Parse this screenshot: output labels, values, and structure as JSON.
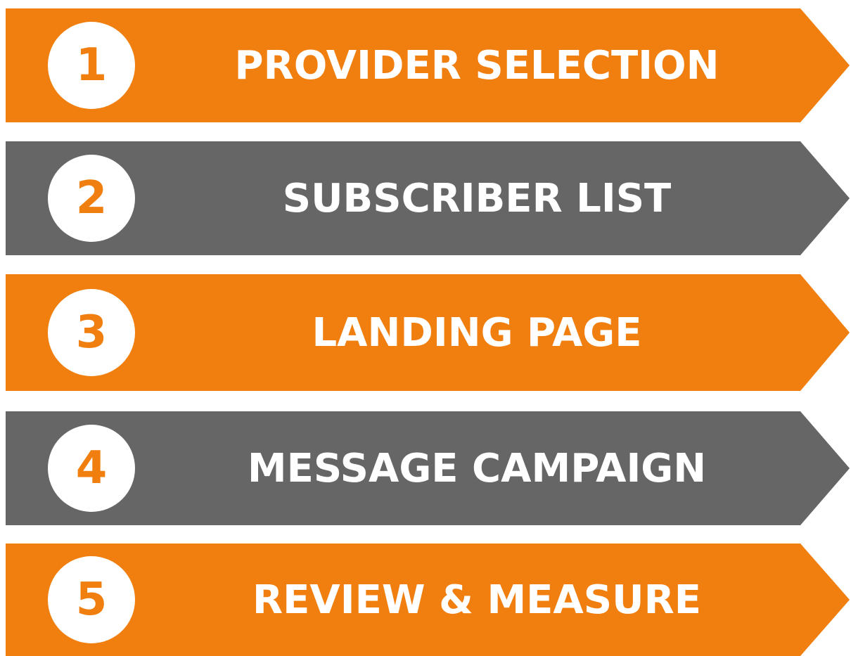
{
  "steps": [
    {
      "number": "1",
      "label": "PROVIDER SELECTION",
      "color": "#f07f0f"
    },
    {
      "number": "2",
      "label": "SUBSCRIBER LIST",
      "color": "#666666"
    },
    {
      "number": "3",
      "label": "LANDING PAGE",
      "color": "#f07f0f"
    },
    {
      "number": "4",
      "label": "MESSAGE CAMPAIGN",
      "color": "#666666"
    },
    {
      "number": "5",
      "label": "REVIEW & MEASURE",
      "color": "#f07f0f"
    }
  ]
}
